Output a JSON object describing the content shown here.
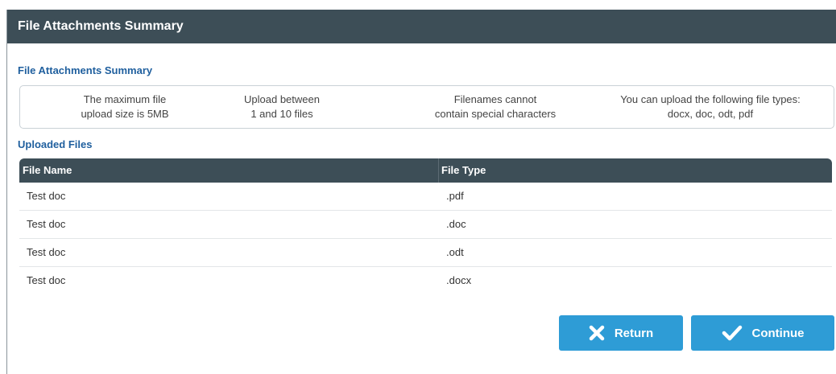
{
  "panel": {
    "title": "File Attachments Summary"
  },
  "summary": {
    "heading": "File Attachments Summary",
    "rules": [
      {
        "line1": "The maximum file",
        "line2": "upload size is 5MB"
      },
      {
        "line1": "Upload between",
        "line2": "1 and 10 files"
      },
      {
        "line1": "Filenames cannot",
        "line2": "contain special characters"
      },
      {
        "line1": "You can upload the following file types:",
        "line2": "docx, doc, odt, pdf"
      }
    ]
  },
  "uploads": {
    "heading": "Uploaded Files",
    "columns": [
      "File Name",
      "File Type"
    ],
    "rows": [
      {
        "name": "Test doc",
        "type": ".pdf"
      },
      {
        "name": "Test doc",
        "type": ".doc"
      },
      {
        "name": "Test doc",
        "type": ".odt"
      },
      {
        "name": "Test doc",
        "type": ".docx"
      }
    ]
  },
  "actions": {
    "return_label": "Return",
    "return_icon": "close-x-icon",
    "continue_label": "Continue",
    "continue_icon": "checkmark-icon"
  },
  "colors": {
    "header_bg": "#3d4e57",
    "accent_blue": "#2e9cd6",
    "heading_blue": "#1f5f9e"
  }
}
